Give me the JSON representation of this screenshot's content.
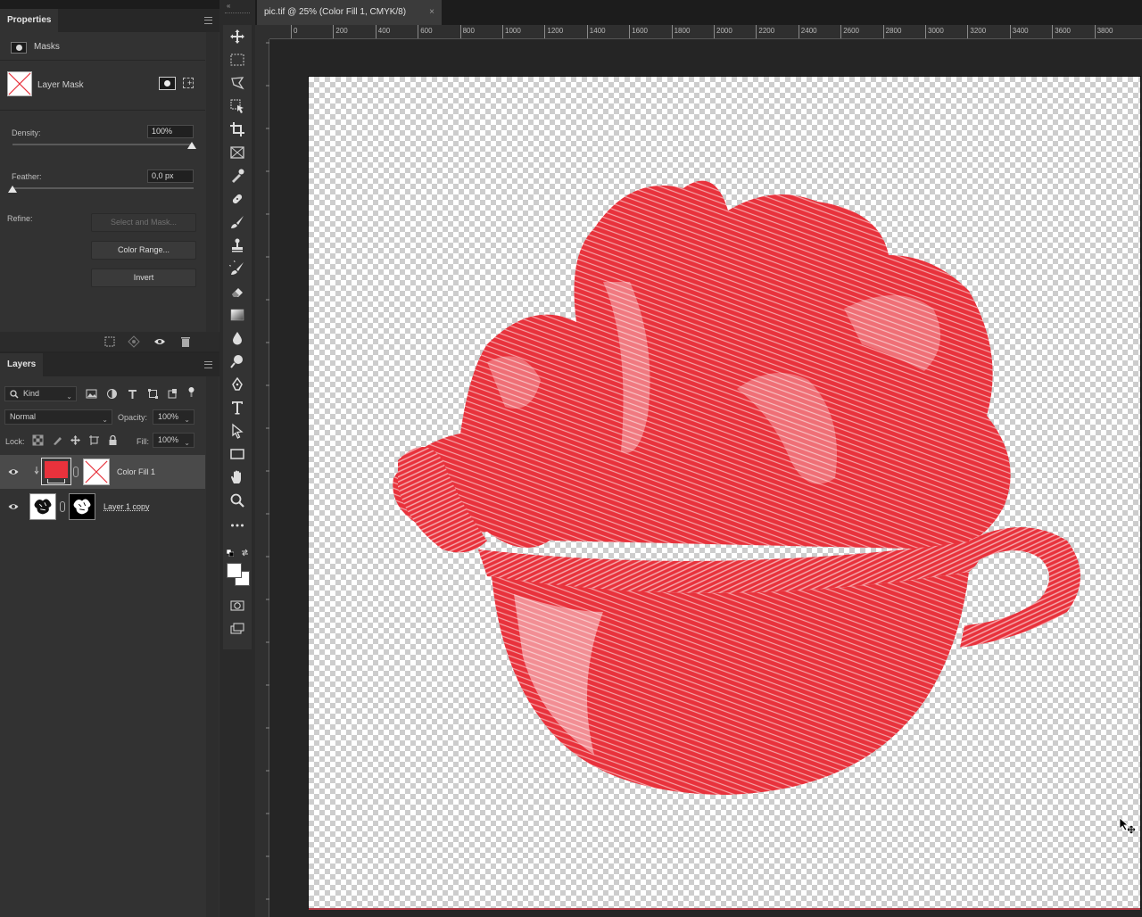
{
  "properties": {
    "tab_title": "Properties",
    "masks_label": "Masks",
    "layer_mask_label": "Layer Mask",
    "density_label": "Density:",
    "density_value": "100%",
    "feather_label": "Feather:",
    "feather_value": "0,0 px",
    "refine_label": "Refine:",
    "select_and_mask": "Select and Mask...",
    "color_range": "Color Range...",
    "invert": "Invert"
  },
  "layers": {
    "tab_title": "Layers",
    "filter_kind": "Kind",
    "blend_mode": "Normal",
    "opacity_label": "Opacity:",
    "opacity_value": "100%",
    "lock_label": "Lock:",
    "fill_label": "Fill:",
    "fill_value": "100%",
    "items": [
      {
        "name": "Color Fill 1",
        "selected": true,
        "visible": true,
        "fill_color": "#e8323c"
      },
      {
        "name": "Layer 1 copy",
        "selected": false,
        "visible": true
      }
    ]
  },
  "document": {
    "tab_title": "pic.tif @ 25% (Color Fill 1, CMYK/8)",
    "close_glyph": "×",
    "ruler_h": [
      "0",
      "200",
      "400",
      "600",
      "800",
      "1000",
      "1200",
      "1400",
      "1600",
      "1800",
      "2000",
      "2200",
      "2400",
      "2600",
      "2800",
      "3000",
      "3200",
      "3400",
      "3600",
      "3800"
    ],
    "art_color": "#e8323c"
  },
  "tools": [
    "move-tool",
    "marquee-tool",
    "lasso-tool",
    "object-select-tool",
    "crop-tool",
    "frame-tool",
    "eyedropper-tool",
    "healing-tool",
    "brush-tool",
    "stamp-tool",
    "history-brush-tool",
    "eraser-tool",
    "gradient-tool",
    "blur-tool",
    "dodge-tool",
    "pen-tool",
    "type-tool",
    "path-select-tool",
    "rectangle-tool",
    "hand-tool",
    "zoom-tool",
    "more-tools"
  ],
  "colors": {
    "foreground": "#ffffff",
    "background": "#ffffff",
    "accent_red": "#e8323c"
  }
}
